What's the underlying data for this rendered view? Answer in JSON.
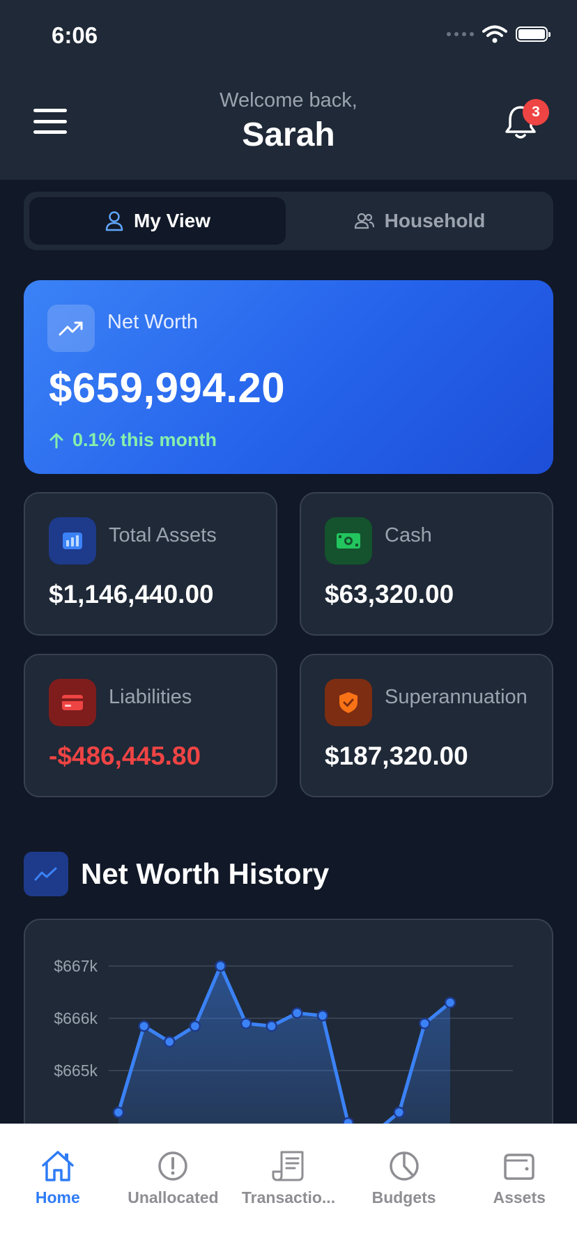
{
  "status_bar": {
    "time": "6:06"
  },
  "header": {
    "welcome": "Welcome back,",
    "username": "Sarah",
    "notification_count": "3"
  },
  "segments": [
    {
      "label": "My View",
      "active": true,
      "icon": "user-icon"
    },
    {
      "label": "Household",
      "active": false,
      "icon": "users-icon"
    }
  ],
  "net_worth": {
    "label": "Net Worth",
    "value": "$659,994.20",
    "change": "0.1% this month",
    "icon": "trending-up-icon"
  },
  "stats": [
    {
      "label": "Total Assets",
      "value": "$1,146,440.00",
      "icon": "bar-chart-icon",
      "value_color": "#ffffff"
    },
    {
      "label": "Cash",
      "value": "$63,320.00",
      "icon": "cash-icon",
      "value_color": "#ffffff"
    },
    {
      "label": "Liabilities",
      "value": "-$486,445.80",
      "icon": "credit-card-icon",
      "value_color": "#ef4444"
    },
    {
      "label": "Superannuation",
      "value": "$187,320.00",
      "icon": "shield-check-icon",
      "value_color": "#ffffff"
    }
  ],
  "history": {
    "title": "Net Worth History"
  },
  "chart_data": {
    "type": "area",
    "y_tick_labels": [
      "$667k",
      "$666k",
      "$665k"
    ],
    "yticks": [
      667,
      666,
      665
    ],
    "ylim": [
      663.5,
      667.4
    ],
    "y_unit": "$k",
    "x": [
      0,
      1,
      2,
      3,
      4,
      5,
      6,
      7,
      8,
      9,
      10,
      11,
      12,
      13
    ],
    "values": [
      664.2,
      665.85,
      665.55,
      665.85,
      667.0,
      665.9,
      665.85,
      666.1,
      666.05,
      664.0,
      663.8,
      664.2,
      665.9,
      666.3
    ],
    "grid": true,
    "colors": {
      "line": "#3b82f6"
    }
  },
  "tabbar": {
    "items": [
      {
        "label": "Home",
        "icon": "home-icon",
        "active": true
      },
      {
        "label": "Unallocated",
        "icon": "alert-circle-icon",
        "active": false
      },
      {
        "label": "Transactio...",
        "icon": "receipt-icon",
        "active": false
      },
      {
        "label": "Budgets",
        "icon": "pie-chart-icon",
        "active": false
      },
      {
        "label": "Assets",
        "icon": "wallet-icon",
        "active": false
      }
    ]
  }
}
